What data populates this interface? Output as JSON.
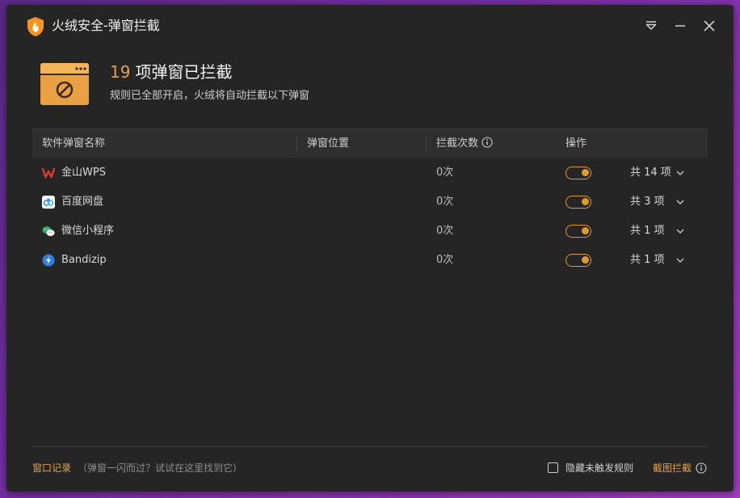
{
  "window": {
    "title": "火绒安全-弹窗拦截"
  },
  "hero": {
    "count": "19",
    "title_suffix": "项弹窗已拦截",
    "subtitle": "规则已全部开启，火绒将自动拦截以下弹窗"
  },
  "table": {
    "headers": [
      "软件弹窗名称",
      "弹窗位置",
      "拦截次数",
      "操作"
    ],
    "rows": [
      {
        "name": "金山WPS",
        "count": "0次",
        "enabled": true,
        "total": "共 14 项",
        "icon": "wps-icon"
      },
      {
        "name": "百度网盘",
        "count": "0次",
        "enabled": true,
        "total": "共 3 项",
        "icon": "baidu-netdisk-icon"
      },
      {
        "name": "微信小程序",
        "count": "0次",
        "enabled": true,
        "total": "共 1 项",
        "icon": "wechat-icon"
      },
      {
        "name": "Bandizip",
        "count": "0次",
        "enabled": true,
        "total": "共 1 项",
        "icon": "bandizip-icon"
      }
    ]
  },
  "footer": {
    "record_link": "窗口记录",
    "record_hint": "（弹窗一闪而过？试试在这里找到它）",
    "hide_rules_label": "隐藏未触发规则",
    "screenshot_link": "截图拦截"
  },
  "colors": {
    "accent": "#e2a24a",
    "background": "#252525",
    "header": "#2e2e2e"
  }
}
